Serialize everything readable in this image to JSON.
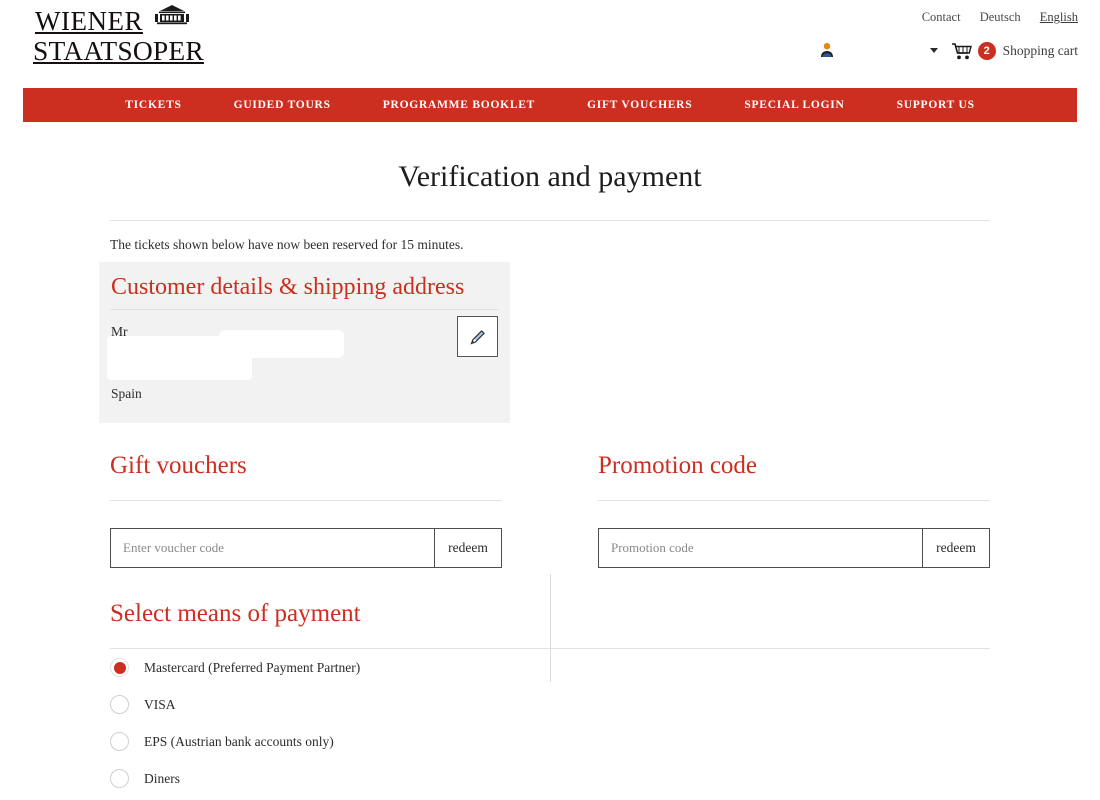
{
  "header": {
    "logo": {
      "line1": "WIENER",
      "line2": "STAATSOPER",
      "building_icon": "opera-house-icon"
    },
    "top_links": [
      {
        "label": "Contact",
        "active": false
      },
      {
        "label": "Deutsch",
        "active": false
      },
      {
        "label": "English",
        "active": true
      }
    ],
    "account": {
      "icon": "user-icon",
      "name": "",
      "caret_icon": "chevron-down-icon"
    },
    "cart": {
      "icon": "shopping-cart-icon",
      "count": "2",
      "label": "Shopping cart"
    }
  },
  "nav": {
    "items": [
      {
        "label": "TICKETS"
      },
      {
        "label": "GUIDED TOURS"
      },
      {
        "label": "PROGRAMME BOOKLET"
      },
      {
        "label": "GIFT VOUCHERS"
      },
      {
        "label": "SPECIAL LOGIN"
      },
      {
        "label": "SUPPORT US"
      }
    ]
  },
  "main": {
    "title": "Verification and payment",
    "reservation_note": "The tickets shown below have now been reserved for 15 minutes."
  },
  "customer": {
    "heading": "Customer details & shipping address",
    "salutation": "Mr",
    "country": "Spain",
    "edit_icon": "pencil-icon"
  },
  "vouchers": {
    "heading": "Gift vouchers",
    "input_value": "",
    "placeholder": "Enter voucher code",
    "redeem_label": "redeem"
  },
  "promotion": {
    "heading": "Promotion code",
    "input_value": "",
    "placeholder": "Promotion code",
    "redeem_label": "redeem"
  },
  "payment": {
    "heading": "Select means of payment",
    "options": [
      {
        "label": "Mastercard (Preferred Payment Partner)",
        "selected": true
      },
      {
        "label": "VISA",
        "selected": false
      },
      {
        "label": "EPS (Austrian bank accounts only)",
        "selected": false
      },
      {
        "label": "Diners",
        "selected": false
      }
    ]
  },
  "colors": {
    "brand_red": "#cc2e20",
    "heading_red": "#cc2e20",
    "text_dark": "#2b2b2b",
    "rule_gray": "#e2e2e6",
    "box_gray": "#f2f2f2"
  }
}
